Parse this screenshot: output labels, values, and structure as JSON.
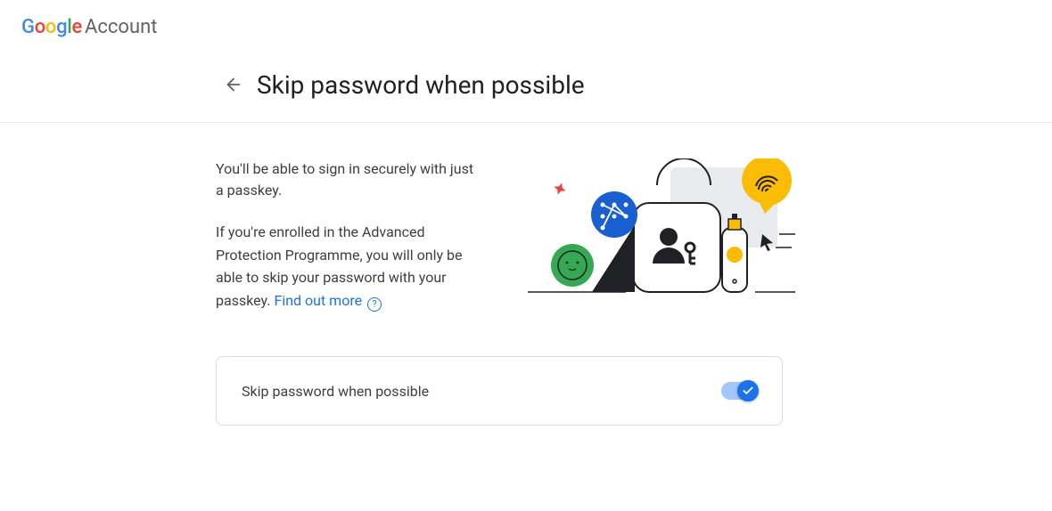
{
  "header": {
    "brand_parts": [
      "G",
      "o",
      "o",
      "g",
      "l",
      "e"
    ],
    "brand_suffix": "Account"
  },
  "page": {
    "title": "Skip password when possible"
  },
  "main": {
    "lead": "You'll be able to sign in securely with just a passkey.",
    "body_prefix": "If you're enrolled in the Advanced Protection Programme, you will only be able to skip your password with your passkey. ",
    "link_text": "Find out more"
  },
  "toggle": {
    "label": "Skip password when possible",
    "on": true
  }
}
